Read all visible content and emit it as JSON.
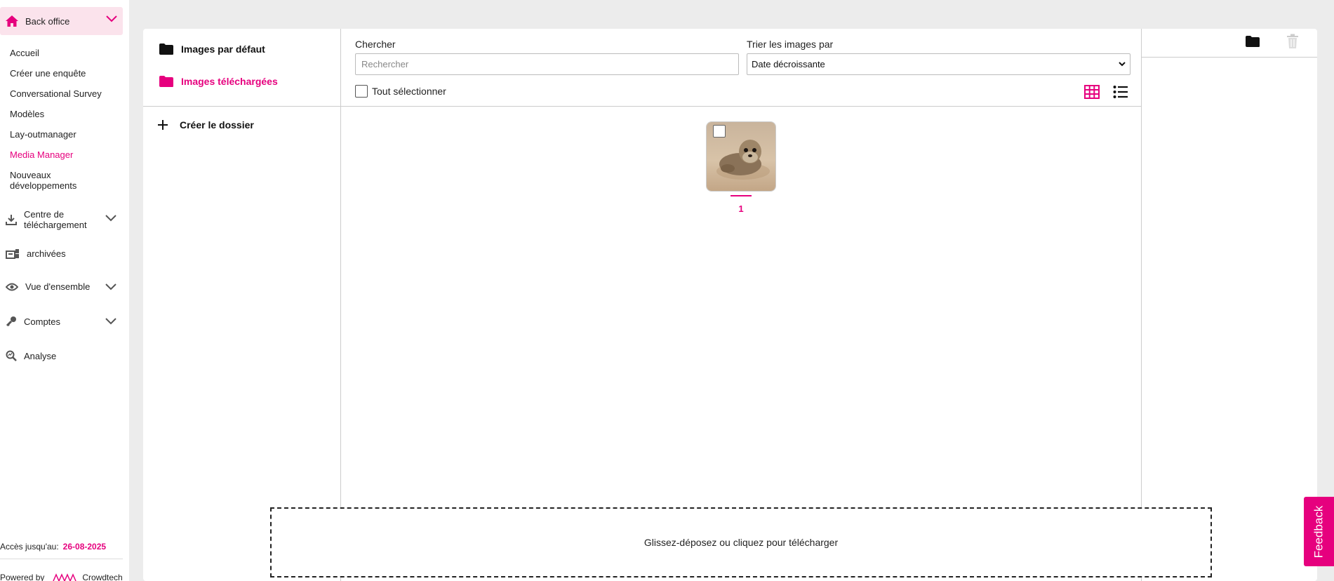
{
  "sidebar": {
    "header_label": "Back office",
    "links": [
      {
        "label": "Accueil"
      },
      {
        "label": "Créer une enquête"
      },
      {
        "label": "Conversational Survey"
      },
      {
        "label": "Modèles"
      },
      {
        "label": "Lay-outmanager"
      },
      {
        "label": "Media Manager",
        "active": true
      },
      {
        "label": "Nouveaux développements"
      }
    ],
    "groups": [
      {
        "label": "Centre de téléchargement",
        "icon": "download-icon"
      },
      {
        "label": "archivées",
        "icon": "archive-icon"
      },
      {
        "label": "Vue d'ensemble",
        "icon": "eye-icon"
      },
      {
        "label": "Comptes",
        "icon": "key-icon"
      },
      {
        "label": "Analyse",
        "icon": "analysis-icon"
      }
    ],
    "access_label": "Accès jusqu'au:",
    "access_date": "26-08-2025",
    "powered_by": "Powered by",
    "brand": "Crowdtech"
  },
  "folders": {
    "items": [
      {
        "label": "Images par défaut"
      },
      {
        "label": "Images téléchargées",
        "active": true
      }
    ],
    "create_label": "Créer le dossier"
  },
  "toolbar": {
    "search_label": "Chercher",
    "search_placeholder": "Rechercher",
    "sort_label": "Trier les images par",
    "sort_value": "Date décroissante",
    "select_all_label": "Tout sélectionner"
  },
  "images": [
    {
      "label": "1"
    }
  ],
  "dropzone_label": "Glissez-déposez ou cliquez pour télécharger",
  "feedback_label": "Feedback",
  "colors": {
    "accent": "#e6007e",
    "header_bg": "#fbe3ec"
  }
}
